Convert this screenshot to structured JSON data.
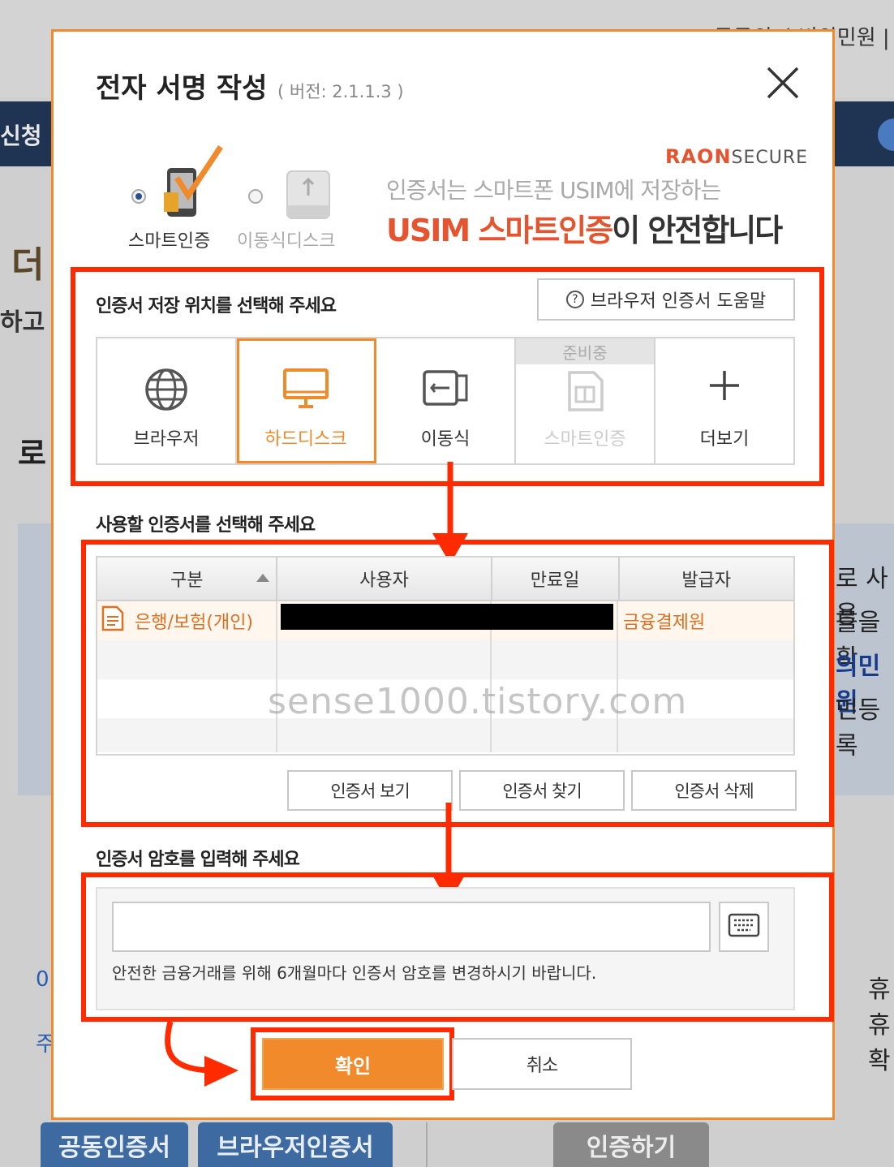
{
  "background": {
    "top_links": "공공의 소비의민원 |",
    "nav_partial": "신청",
    "left_big": "더",
    "left_mid": "하고",
    "left_ro": "로",
    "right_lines": [
      "로 사용",
      "를을 확",
      "의민원",
      "민등록"
    ],
    "left_nums": [
      "0",
      "주"
    ],
    "right_low": [
      "휴",
      "휴",
      "확"
    ],
    "bottom_buttons": [
      "공동인증서",
      "브라우저인증서",
      "인증하기"
    ]
  },
  "dialog": {
    "title": "전자 서명 작성",
    "version": "( 버전: 2.1.1.3 )",
    "auth_options": [
      {
        "label": "스마트인증",
        "selected": true
      },
      {
        "label": "이동식디스크",
        "selected": false
      }
    ],
    "promo": {
      "brand_a": "RAON",
      "brand_b": "SECURE",
      "line1": "인증서는 스마트폰 USIM에 저장하는",
      "line2_hl": "USIM 스마트인증",
      "line2_rest": "이 안전합니다"
    },
    "storage": {
      "title": "인증서 저장 위치를 선택해 주세요",
      "help_button": "브라우저 인증서 도움말",
      "items": [
        {
          "label": "브라우저",
          "icon": "globe-icon"
        },
        {
          "label": "하드디스크",
          "icon": "monitor-icon",
          "selected": true
        },
        {
          "label": "이동식",
          "icon": "usb-icon"
        },
        {
          "label": "스마트인증",
          "icon": "sim-card-icon",
          "disabled": true,
          "badge": "준비중"
        },
        {
          "label": "더보기",
          "icon": "plus-icon"
        }
      ]
    },
    "certificates": {
      "title": "사용할 인증서를 선택해 주세요",
      "columns": [
        "구분",
        "사용자",
        "만료일",
        "발급자"
      ],
      "rows": [
        {
          "type": "은행/보험(개인)",
          "user": "",
          "expiry": "",
          "issuer": "금융결제원"
        }
      ],
      "buttons": [
        "인증서 보기",
        "인증서 찾기",
        "인증서 삭제"
      ]
    },
    "watermark": "sense1000.tistory.com",
    "password": {
      "title": "인증서 암호를 입력해 주세요",
      "value": "",
      "note": "안전한 금융거래를 위해 6개월마다 인증서 암호를 변경하시기 바랍니다."
    },
    "confirm_label": "확인",
    "cancel_label": "취소"
  },
  "colors": {
    "accent": "#f08a2a",
    "annotation": "#ff2a00",
    "brand": "#e5542e"
  }
}
